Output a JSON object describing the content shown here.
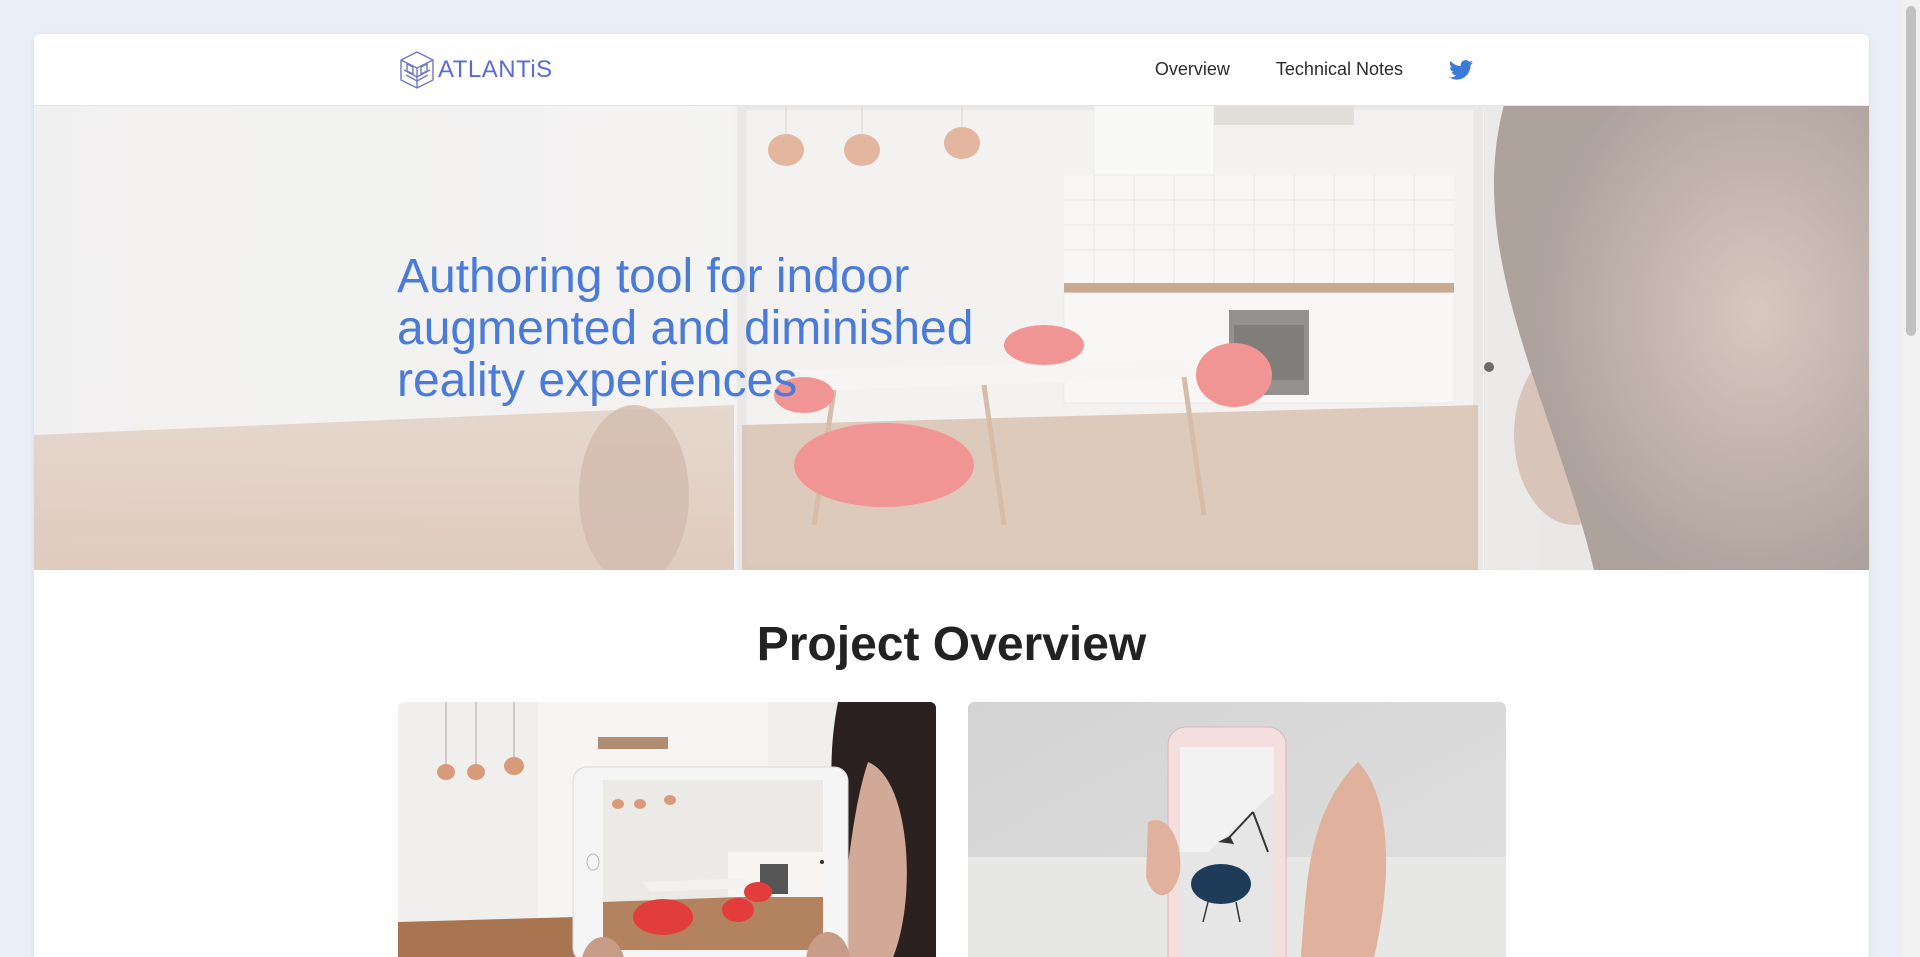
{
  "header": {
    "logo_text": "ATLANTiS",
    "nav": [
      {
        "label": "Overview"
      },
      {
        "label": "Technical Notes"
      }
    ],
    "social_icon": "twitter-icon"
  },
  "hero": {
    "title": "Authoring tool for indoor augmented and diminished reality experiences",
    "image": "blurred-kitchen-tablet-photo"
  },
  "section": {
    "title": "Project Overview"
  },
  "cards": [
    {
      "image": "tablet-kitchen-ar-photo"
    },
    {
      "image": "phone-chair-ar-photo"
    }
  ],
  "colors": {
    "accent": "#4a7bd8",
    "logo": "#5a6bd6",
    "page_bg": "#e9eef9"
  }
}
